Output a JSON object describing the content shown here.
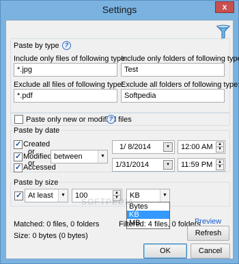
{
  "window": {
    "title": "Settings",
    "close_glyph": "x"
  },
  "paste_by_type": {
    "title": "Paste by type",
    "include_files_label": "Include only files of following type:",
    "include_files_value": "*.jpg",
    "include_folders_label": "Include only folders of following type:",
    "include_folders_value": "Test",
    "exclude_files_label": "Exclude all files of following type:",
    "exclude_files_value": "*.pdf",
    "exclude_folders_label": "Exclude all folders of following type:",
    "exclude_folders_value": "Softpedia"
  },
  "paste_only_new": {
    "label": "Paste only new or modified files",
    "checked": false
  },
  "paste_by_date": {
    "title": "Paste by date",
    "created_label": "Created",
    "or1": "or",
    "modified_label": "Modified",
    "or2": "or",
    "accessed_label": "Accessed",
    "condition": "between",
    "date_from": "1/ 8/2014",
    "time_from": "12:00 AM",
    "date_to": "1/31/2014",
    "time_to": "11:59 PM"
  },
  "paste_by_size": {
    "title": "Paste by size",
    "comparison": "At least",
    "amount": "100",
    "unit": "KB",
    "unit_options": [
      "Bytes",
      "KB",
      "MB"
    ],
    "selected_option": "KB"
  },
  "status": {
    "matched": "Matched: 0 files, 0 folders",
    "filtered": "Filtered: 4 files, 0 folders",
    "size": "Size: 0 bytes (0 bytes)"
  },
  "actions": {
    "preview": "Preview",
    "refresh": "Refresh",
    "ok": "OK",
    "cancel": "Cancel"
  },
  "watermark": "SOFTPEDIA",
  "colors": {
    "accent": "#3399ff",
    "link": "#1a5ccf",
    "title_bar": "#7ab2e0"
  }
}
